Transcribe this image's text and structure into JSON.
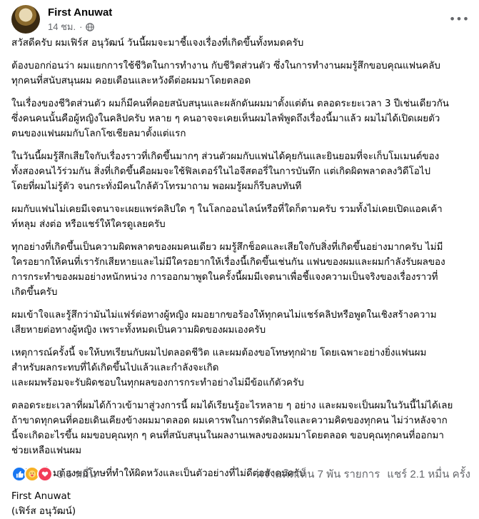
{
  "post": {
    "author": "First Anuwat",
    "time": "14 ชม.",
    "avatar_icon": "profile-photo",
    "privacy_icon": "globe-icon",
    "paragraphs": [
      "สวัสดีครับ ผมเฟิร์ส อนุวัฒน์ วันนี้ผมจะมาชี้แจงเรื่องที่เกิดขึ้นทั้งหมดครับ",
      "ต้องบอกก่อนว่า ผมแยกการใช้ชีวิตในการทำงาน กับชีวิตส่วนตัว ซึ่งในการทำงานผมรู้สึกขอบคุณแฟนคลับ\nทุกคนที่สนับสนุนผม คอยเตือนและหวังดีต่อผมมาโดยตลอด",
      "ในเรื่องของชีวิตส่วนตัว ผมก็มีคนที่คอยสนับสนุนและผลักดันผมมาตั้งแต่ต้น ตลอดระยะเวลา 3 ปีเช่นเดียวกัน\nซึ่งคนคนนั้นคือผู้หญิงในคลิปครับ หลาย ๆ คนอาจจะเคยเห็นผมไลฟ์พูดถึงเรื่องนี้มาแล้ว ผมไม่ได้เปิดเผยตัว\nตนของแฟนผมกับโลกโซเชียลมาตั้งแต่แรก",
      "ในวันนี้ผมรู้สึกเสียใจกับเรื่องราวที่เกิดขึ้นมากๆ ส่วนตัวผมกับแฟนได้คุยกันและยินยอมที่จะเก็บโมเมนต์ของ\nทั้งสองคนไว้ร่วมกัน สิ่งที่เกิดขึ้นคือผมจะใช้ฟิลเตอร์ในไอจีสตอรี่ในการบันทึก แต่เกิดผิดพลาดลงวิดีโอไป\nโดยที่ผมไม่รู้ตัว จนกระทั่งมีคนใกล้ตัวโทรมาถาม พอผมรู้ผมก็รีบลบทันที",
      "ผมกับแฟนไม่เคยมีเจตนาจะเผยแพร่คลิปใด ๆ ในโลกออนไลน์หรือที่ใดก็ตามครับ รวมทั้งไม่เคยเปิดแอคเค้า\nท์หลุม ส่งต่อ หรือแชร์ให้ใครดูเลยครับ",
      "ทุกอย่างที่เกิดขึ้นเป็นความผิดพลาดของผมคนเดียว ผมรู้สึกช็อคและเสียใจกับสิ่งที่เกิดขึ้นอย่างมากครับ ไม่มี\nใครอยากให้คนที่เรารักเสียหายและไม่มีใครอยากให้เรื่องนี้เกิดขึ้นเช่นกัน แฟนของผมและผมกำลังรับผลของ\nการกระทำของผมอย่างหนักหน่วง การออกมาพูดในครั้งนี้ผมมีเจตนาเพื่อชี้แจงความเป็นจริงของเรื่องราวที่\nเกิดขึ้นครับ",
      "ผมเข้าใจและรู้สึกว่ามันไม่แฟร์ต่อทางผู้หญิง ผมอยากขอร้องให้ทุกคนไม่แชร์คลิปหรือพูดในเชิงสร้างความ\nเสียหายต่อทางผู้หญิง เพราะทั้งหมดเป็นความผิดของผมเองครับ",
      "เหตุการณ์ครั้งนี้ จะให้บทเรียนกับผมไปตลอดชีวิต และผมต้องขอโทษทุกฝ่าย  โดยเฉพาะอย่างยิ่งแฟนผม\nสำหรับผลกระทบที่ได้เกิดขึ้นไปแล้วและกำลังจะเกิด\nและผมพร้อมจะรับผิดชอบในทุกผลของการกระทำอย่างไม่มีข้อแก้ตัวครับ",
      "ตลอดระยะเวลาที่ผมได้ก้าวเข้ามาสู่วงการนี้ ผมได้เรียนรู้อะไรหลาย ๆ อย่าง และผมจะเป็นผมในวันนี้ไม่ได้เลย\nถ้าขาดทุกคนที่คอยเดินเคียงข้างผมมาตลอด ผมเคารพในการตัดสินใจและความคิดของทุกคน ไม่ว่าหลังจาก\nนี้จะเกิดอะไรขึ้น ผมขอบคุณทุก ๆ คนที่สนับสนุนในผลงานเพลงของผมมาโดยตลอด ขอบคุณทุกคนที่ออกมา\nช่วยเหลือแฟนผม",
      "สุดท้ายนี้ผมต้องขอโทษที่ทำให้ผิดหวังและเป็นตัวอย่างที่ไม่ดีต่อสังคมครับ"
    ],
    "signature": "First Anuwat\n(เฟิร์ส อนุวัฒน์)"
  },
  "footer": {
    "reaction_icons": [
      "like-icon",
      "care-icon",
      "love-icon"
    ],
    "reaction_count": "3.6 หมื่น",
    "comments": "ความคิดเห็น 7 พัน รายการ",
    "shares": "แชร์ 2.1 หมื่น ครั้ง"
  },
  "colors": {
    "like": "#1877f2",
    "care": "#f7b125",
    "love": "#f33e58",
    "meta_text": "#65676b"
  }
}
